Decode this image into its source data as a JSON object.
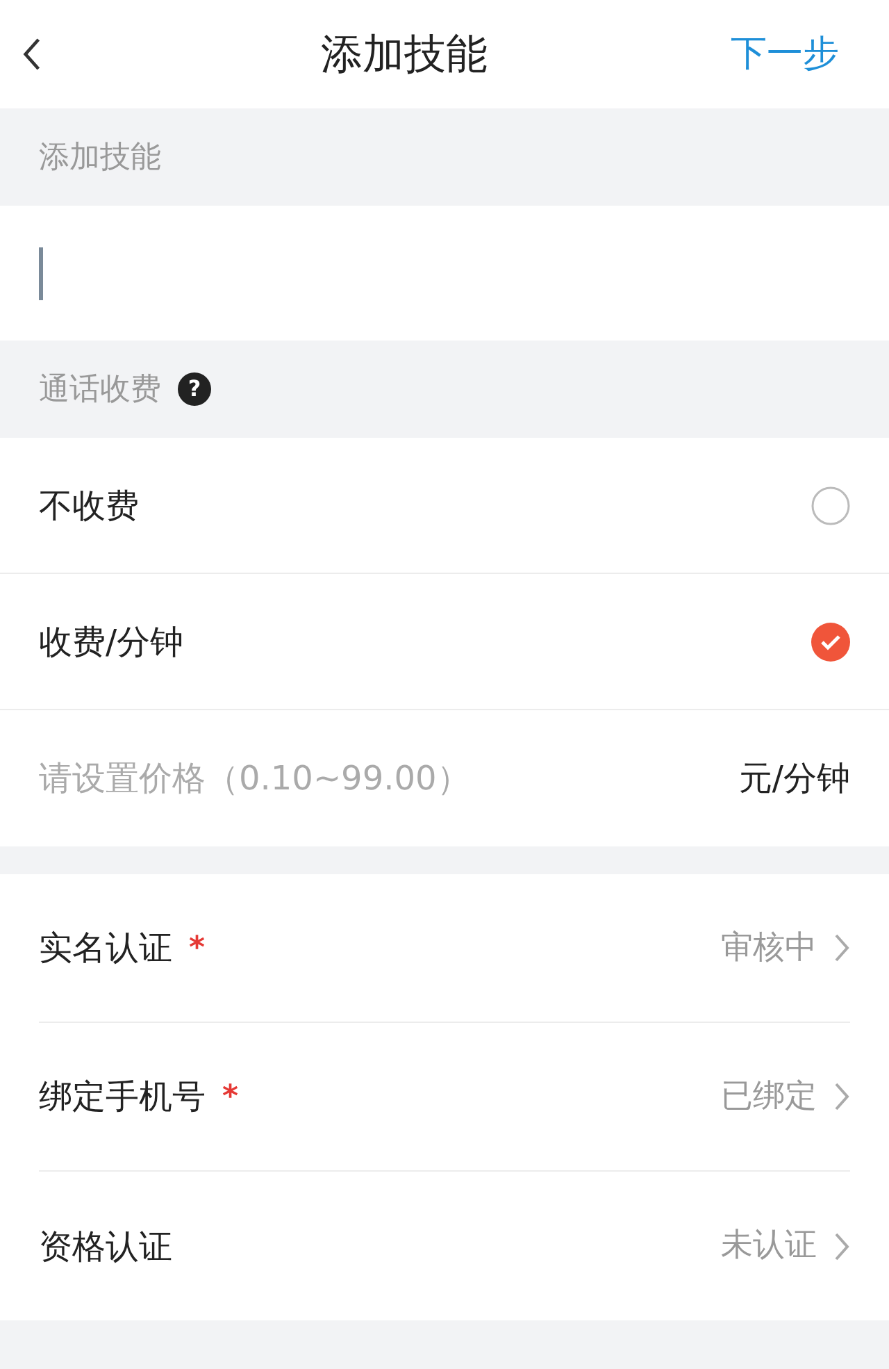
{
  "header": {
    "title": "添加技能",
    "next": "下一步"
  },
  "skill_section": {
    "label": "添加技能"
  },
  "fee_section": {
    "label": "通话收费",
    "help": "?"
  },
  "fee_options": [
    {
      "label": "不收费",
      "selected": false
    },
    {
      "label": "收费/分钟",
      "selected": true
    }
  ],
  "price": {
    "placeholder": "请设置价格（0.10~99.00）",
    "unit": "元/分钟"
  },
  "verifications": [
    {
      "label": "实名认证",
      "mark": "*",
      "status": "审核中"
    },
    {
      "label": "绑定手机号",
      "mark": "*",
      "status": "已绑定"
    },
    {
      "label": "资格认证",
      "status": "未认证"
    }
  ]
}
